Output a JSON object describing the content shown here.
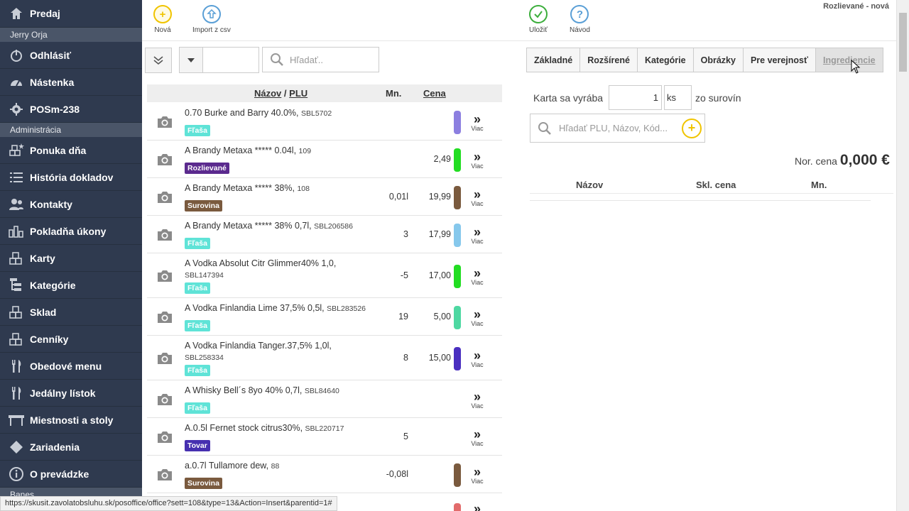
{
  "sidebar": {
    "top": [
      {
        "label": "Predaj",
        "icon": "home-icon"
      }
    ],
    "user_name": "Jerry Orja",
    "mid": [
      {
        "label": "Odhlásiť",
        "icon": "power-icon"
      },
      {
        "label": "Nástenka",
        "icon": "dashboard-icon"
      },
      {
        "label": "POSm-238",
        "icon": "gear-icon"
      }
    ],
    "section_label": "Administrácia",
    "admin": [
      {
        "label": "Ponuka dňa",
        "icon": "blocks-star-icon"
      },
      {
        "label": "História dokladov",
        "icon": "list-icon"
      },
      {
        "label": "Kontakty",
        "icon": "users-icon"
      },
      {
        "label": "Pokladňa úkony",
        "icon": "bar-chart-icon"
      },
      {
        "label": "Karty",
        "icon": "blocks-icon"
      },
      {
        "label": "Kategórie",
        "icon": "tree-icon"
      },
      {
        "label": "Sklad",
        "icon": "blocks-icon"
      },
      {
        "label": "Cenníky",
        "icon": "blocks-icon"
      },
      {
        "label": "Obedové menu",
        "icon": "cutlery-icon"
      },
      {
        "label": "Jedálny lístok",
        "icon": "cutlery-icon"
      },
      {
        "label": "Miestnosti a stoly",
        "icon": "table-icon"
      },
      {
        "label": "Zariadenia",
        "icon": "diamond-icon"
      },
      {
        "label": "O prevádzke",
        "icon": "info-icon"
      }
    ],
    "partial_section": "Banes"
  },
  "toolbar": {
    "new_label": "Nová",
    "import_label": "Import z csv",
    "save_label": "Uložiť",
    "help_label": "Návod",
    "window_title": "Rozlievané - nová"
  },
  "filter": {
    "number_value": "",
    "search_placeholder": "Hľadať.."
  },
  "table": {
    "col_name": "Názov",
    "col_sep": "/",
    "col_plu": "PLU",
    "col_qty": "Mn.",
    "col_price": "Cena",
    "more_label": "Viac",
    "rows": [
      {
        "name": "0.70 Burke and Barry 40.0%,",
        "plu": "SBL5702",
        "badge": "Fľaša",
        "badge_type": "flasa",
        "qty": "",
        "price": "",
        "color": "#8c7fe0"
      },
      {
        "name": "A Brandy Metaxa ***** 0.04l,",
        "plu": "109",
        "badge": "Rozlievané",
        "badge_type": "rozl",
        "qty": "",
        "price": "2,49",
        "color": "#22dd22"
      },
      {
        "name": "A Brandy Metaxa ***** 38%,",
        "plu": "108",
        "badge": "Surovina",
        "badge_type": "surov",
        "qty": "0,01l",
        "price": "19,99",
        "color": "#7a5a3e"
      },
      {
        "name": "A Brandy Metaxa ***** 38% 0,7l,",
        "plu": "SBL206586",
        "badge": "Fľaša",
        "badge_type": "flasa",
        "qty": "3",
        "price": "17,99",
        "color": "#86c8ec"
      },
      {
        "name": "A Vodka Absolut Citr Glimmer40% 1,0,",
        "plu": "SBL147394",
        "badge": "Fľaša",
        "badge_type": "flasa",
        "qty": "-5",
        "price": "17,00",
        "color": "#22dd22"
      },
      {
        "name": "A Vodka Finlandia Lime 37,5% 0,5l,",
        "plu": "SBL283526",
        "badge": "Fľaša",
        "badge_type": "flasa",
        "qty": "19",
        "price": "5,00",
        "color": "#4ed8a2"
      },
      {
        "name": "A Vodka Finlandia Tanger.37,5% 1,0l,",
        "plu": "SBL258334",
        "badge": "Fľaša",
        "badge_type": "flasa",
        "qty": "8",
        "price": "15,00",
        "color": "#4a2fc0"
      },
      {
        "name": "A Whisky Bell´s 8yo 40% 0,7l,",
        "plu": "SBL84640",
        "badge": "Fľaša",
        "badge_type": "flasa",
        "qty": "",
        "price": "",
        "color": ""
      },
      {
        "name": "A.0.5l Fernet stock citrus30%,",
        "plu": "SBL220717",
        "badge": "Tovar",
        "badge_type": "tovar",
        "qty": "5",
        "price": "",
        "color": ""
      },
      {
        "name": "a.0.7l Tullamore dew,",
        "plu": "88",
        "badge": "Surovina",
        "badge_type": "surov",
        "qty": "-0,08l",
        "price": "",
        "color": "#7a5a3e"
      }
    ]
  },
  "detail": {
    "tabs": [
      "Základné",
      "Rozšírené",
      "Kategórie",
      "Obrázky",
      "Pre verejnosť",
      "Ingrediencie"
    ],
    "karta_label": "Karta sa vyrába",
    "karta_qty": "1",
    "karta_unit": "ks",
    "karta_after": "zo surovín",
    "ing_search_placeholder": "Hľadať PLU, Názov, Kód...",
    "nor_cena_label": "Nor. cena",
    "nor_cena_value": "0,000 €",
    "col_name": "Názov",
    "col_price": "Skl. cena",
    "col_qty": "Mn."
  },
  "status_url": "https://skusit.zavolatobsluhu.sk/posoffice/office?sett=108&type=13&Action=Insert&parentid=1#"
}
